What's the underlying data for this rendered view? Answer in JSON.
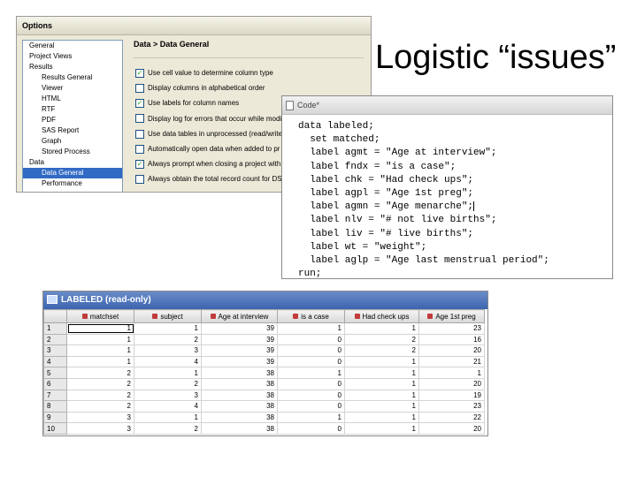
{
  "slide": {
    "title": "Logistic “issues”"
  },
  "options_dialog": {
    "title": "Options",
    "tree": [
      {
        "label": "General",
        "level": 1
      },
      {
        "label": "Project Views",
        "level": 1
      },
      {
        "label": "Results",
        "level": 1
      },
      {
        "label": "Results General",
        "level": 2
      },
      {
        "label": "Viewer",
        "level": 2
      },
      {
        "label": "HTML",
        "level": 2
      },
      {
        "label": "RTF",
        "level": 2
      },
      {
        "label": "PDF",
        "level": 2
      },
      {
        "label": "SAS Report",
        "level": 2
      },
      {
        "label": "Graph",
        "level": 2
      },
      {
        "label": "Stored Process",
        "level": 2
      },
      {
        "label": "Data",
        "level": 1
      },
      {
        "label": "Data General",
        "level": 2,
        "selected": true
      },
      {
        "label": "Performance",
        "level": 2
      }
    ],
    "panel_heading": "Data > Data General",
    "checkboxes": [
      {
        "label": "Use cell value to determine column type",
        "checked": true
      },
      {
        "label": "Display columns in alphabetical order",
        "checked": false
      },
      {
        "label": "Use labels for column names",
        "checked": true
      },
      {
        "label": "Display log for errors that occur while modi",
        "checked": false
      },
      {
        "label": "Use data tables in unprocessed (read/write",
        "checked": false
      },
      {
        "label": "Automatically open data when added to pr",
        "checked": false
      },
      {
        "label": "Always prompt when closing a project with",
        "checked": true
      },
      {
        "label": "Always obtain the total record count for DS",
        "checked": false
      }
    ]
  },
  "code_window": {
    "title": "Code*",
    "lines": [
      "data labeled;",
      "  set matched;",
      "  label agmt = \"Age at interview\";",
      "  label fndx = \"is a case\";",
      "  label chk = \"Had check ups\";",
      "  label agpl = \"Age 1st preg\";",
      "  label agmn = \"Age menarche\";",
      "  label nlv = \"# not live births\";",
      "  label liv = \"# live births\";",
      "  label wt = \"weight\";",
      "  label aglp = \"Age last menstrual period\";",
      "run;"
    ]
  },
  "data_grid": {
    "title": "LABELED (read-only)",
    "columns": [
      "matchset",
      "subject",
      "Age at interview",
      "is a case",
      "Had check ups",
      "Age 1st preg"
    ],
    "rows": [
      [
        "1",
        "1",
        "1",
        "39",
        "1",
        "1",
        "23"
      ],
      [
        "2",
        "1",
        "2",
        "39",
        "0",
        "2",
        "16"
      ],
      [
        "3",
        "1",
        "3",
        "39",
        "0",
        "2",
        "20"
      ],
      [
        "4",
        "1",
        "4",
        "39",
        "0",
        "1",
        "21"
      ],
      [
        "5",
        "2",
        "1",
        "38",
        "1",
        "1",
        "1"
      ],
      [
        "6",
        "2",
        "2",
        "38",
        "0",
        "1",
        "20"
      ],
      [
        "7",
        "2",
        "3",
        "38",
        "0",
        "1",
        "19"
      ],
      [
        "8",
        "2",
        "4",
        "38",
        "0",
        "1",
        "23"
      ],
      [
        "9",
        "3",
        "1",
        "38",
        "1",
        "1",
        "22"
      ],
      [
        "10",
        "3",
        "2",
        "38",
        "0",
        "1",
        "20"
      ]
    ]
  },
  "colors": {
    "accent": "#3b64b0",
    "check": "#21a121",
    "tree_selected": "#316ac5"
  }
}
